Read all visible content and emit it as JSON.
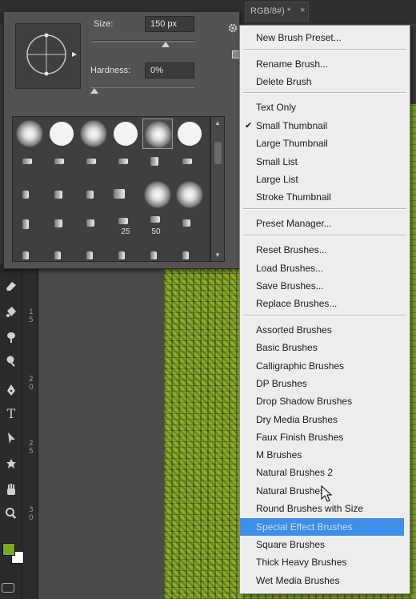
{
  "document": {
    "tab_title": "RGB/8#) *",
    "close_glyph": "×"
  },
  "brush_picker": {
    "size_label": "Size:",
    "size_value": "150 px",
    "size_slider_level": 0.72,
    "hardness_label": "Hardness:",
    "hardness_value": "0%",
    "hardness_slider_level": 0.0,
    "gear_icon": "gear-icon",
    "new_preset_icon": "new-preset-icon",
    "thumb_labels": [
      "25",
      "50"
    ],
    "scrollbar_position": 0.1
  },
  "menu": {
    "items": [
      {
        "label": "New Brush Preset...",
        "checked": false,
        "highlighted": false
      },
      {
        "label": "Rename Brush...",
        "checked": false,
        "highlighted": false
      },
      {
        "label": "Delete Brush",
        "checked": false,
        "highlighted": false
      },
      {
        "label": "Text Only",
        "checked": false,
        "highlighted": false
      },
      {
        "label": "Small Thumbnail",
        "checked": true,
        "highlighted": false
      },
      {
        "label": "Large Thumbnail",
        "checked": false,
        "highlighted": false
      },
      {
        "label": "Small List",
        "checked": false,
        "highlighted": false
      },
      {
        "label": "Large List",
        "checked": false,
        "highlighted": false
      },
      {
        "label": "Stroke Thumbnail",
        "checked": false,
        "highlighted": false
      },
      {
        "label": "Preset Manager...",
        "checked": false,
        "highlighted": false
      },
      {
        "label": "Reset Brushes...",
        "checked": false,
        "highlighted": false
      },
      {
        "label": "Load Brushes...",
        "checked": false,
        "highlighted": false
      },
      {
        "label": "Save Brushes...",
        "checked": false,
        "highlighted": false
      },
      {
        "label": "Replace Brushes...",
        "checked": false,
        "highlighted": false
      },
      {
        "label": "Assorted Brushes",
        "checked": false,
        "highlighted": false
      },
      {
        "label": "Basic Brushes",
        "checked": false,
        "highlighted": false
      },
      {
        "label": "Calligraphic Brushes",
        "checked": false,
        "highlighted": false
      },
      {
        "label": "DP Brushes",
        "checked": false,
        "highlighted": false
      },
      {
        "label": "Drop Shadow Brushes",
        "checked": false,
        "highlighted": false
      },
      {
        "label": "Dry Media Brushes",
        "checked": false,
        "highlighted": false
      },
      {
        "label": "Faux Finish Brushes",
        "checked": false,
        "highlighted": false
      },
      {
        "label": "M Brushes",
        "checked": false,
        "highlighted": false
      },
      {
        "label": "Natural Brushes 2",
        "checked": false,
        "highlighted": false
      },
      {
        "label": "Natural Brushes",
        "checked": false,
        "highlighted": false
      },
      {
        "label": "Round Brushes with Size",
        "checked": false,
        "highlighted": false
      },
      {
        "label": "Special Effect Brushes",
        "checked": false,
        "highlighted": true
      },
      {
        "label": "Square Brushes",
        "checked": false,
        "highlighted": false
      },
      {
        "label": "Thick Heavy Brushes",
        "checked": false,
        "highlighted": false
      },
      {
        "label": "Wet Media Brushes",
        "checked": false,
        "highlighted": false
      }
    ],
    "check_glyph": "✔"
  },
  "toolbar": {
    "tools": [
      "eraser-icon",
      "paint-bucket-icon",
      "smudge-icon",
      "dodge-icon",
      "pen-icon",
      "type-icon",
      "path-selection-icon",
      "custom-shape-icon",
      "hand-icon",
      "zoom-icon"
    ],
    "type_glyph": "T",
    "foreground_color": "#7aa823",
    "background_color": "#ffffff"
  },
  "ruler": {
    "numbers": [
      "1",
      "5",
      "2",
      "0",
      "2",
      "5",
      "3",
      "0"
    ]
  },
  "colors": {
    "canvas_green": "#86a82a",
    "menu_highlight": "#3f8ee8"
  }
}
